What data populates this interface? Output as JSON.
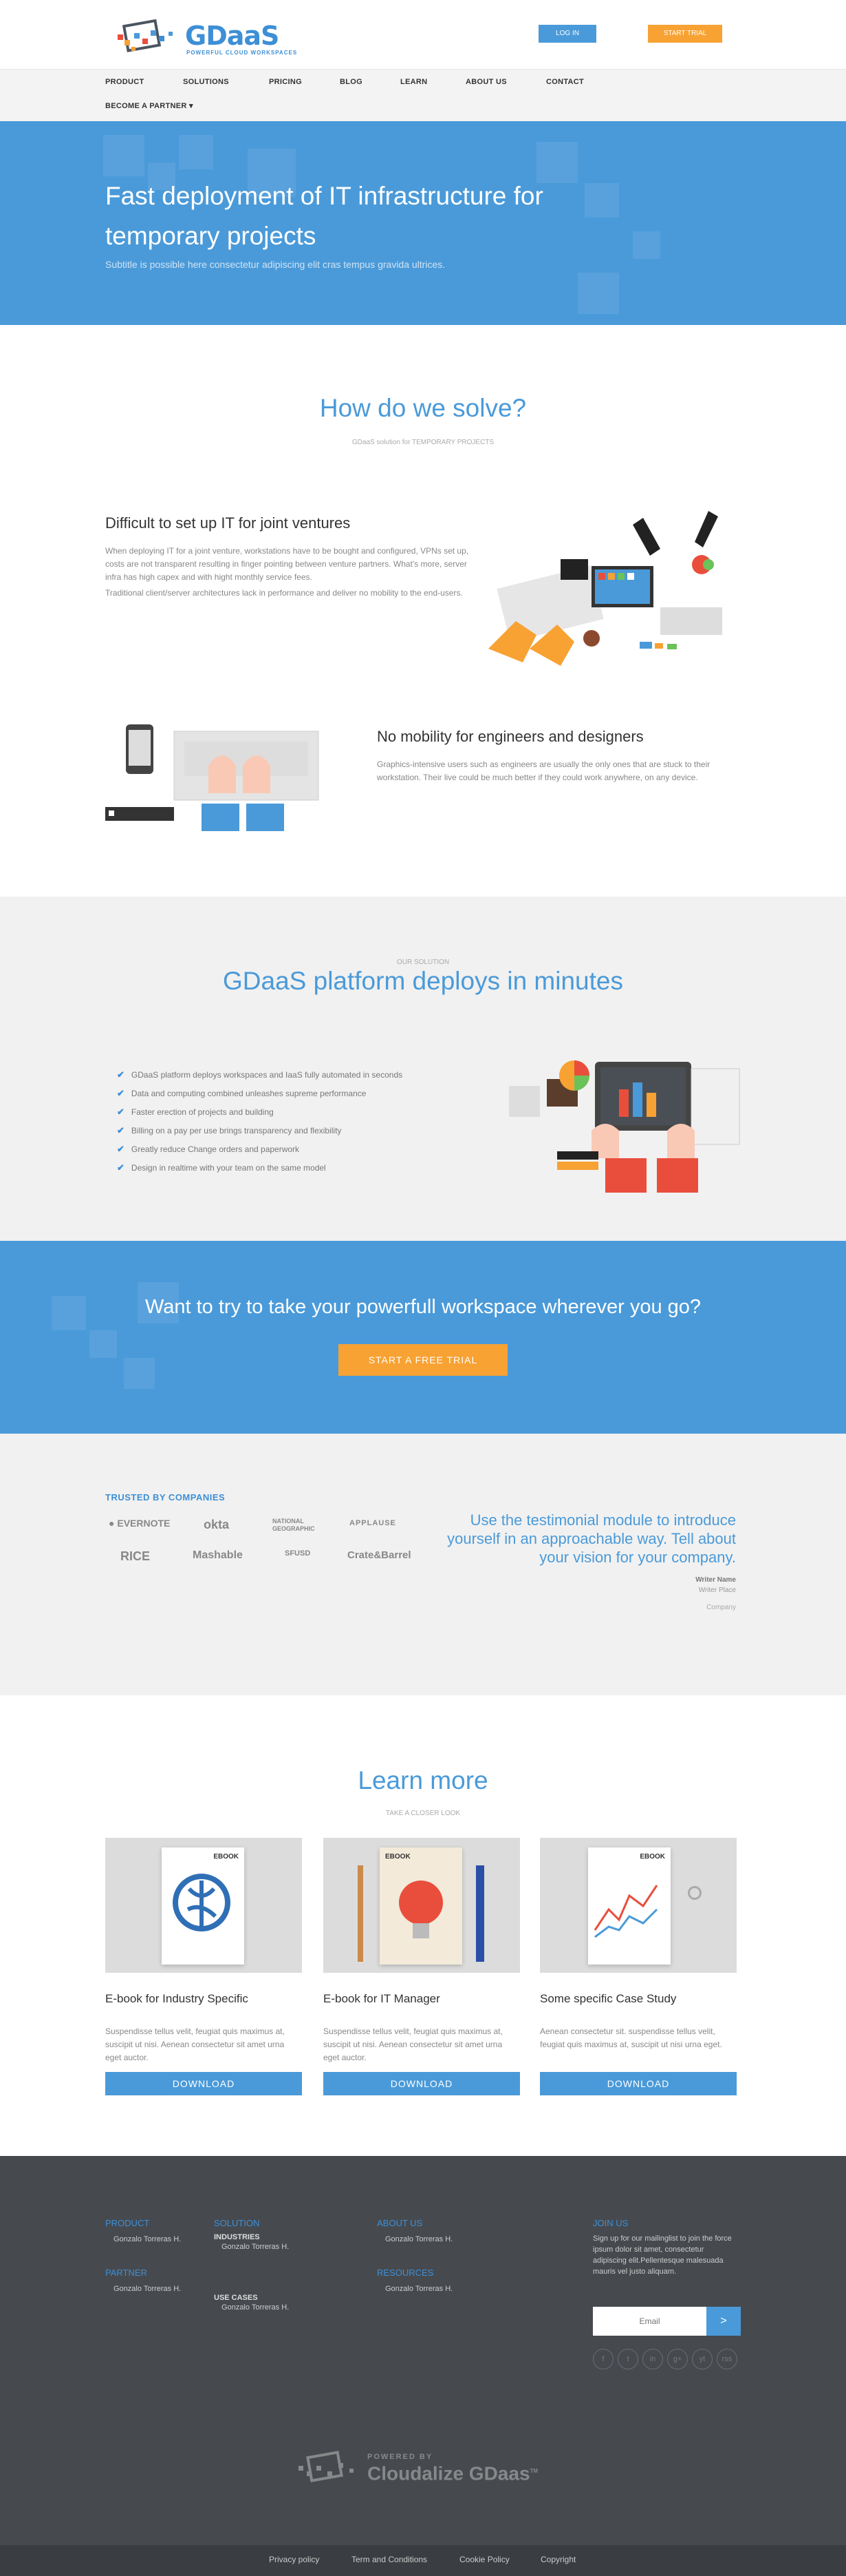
{
  "header": {
    "logo_name": "GDaaS",
    "logo_tagline": "POWERFUL CLOUD WORKSPACES",
    "login_label": "LOG IN",
    "trial_label": "START TRIAL"
  },
  "nav": {
    "items": [
      "PRODUCT",
      "SOLUTIONS",
      "PRICING",
      "BLOG",
      "LEARN",
      "ABOUT US",
      "CONTACT"
    ],
    "partner": "BECOME A PARTNER"
  },
  "hero": {
    "title": "Fast deployment of IT infrastructure for temporary projects",
    "subtitle": "Subtitle is possible here consectetur adipiscing elit cras tempus gravida ultrices."
  },
  "solve": {
    "title": "How do we solve?",
    "subtitle": "GDaaS solution for TEMPORARY PROJECTS",
    "item1_title": "Difficult to set up IT for joint ventures",
    "item1_p1": "When deploying IT for a joint venture, workstations have to be bought and configured, VPNs set up, costs are not transparent resulting in finger pointing between venture partners. What's more, server infra has high capex and with hight monthly service fees.",
    "item1_p2": "Traditional client/server architectures lack in performance and deliver no mobility to the end-users.",
    "item2_title": "No mobility for engineers and designers",
    "item2_p1": "Graphics-intensive users such as engineers are usually the only ones that are stuck to their workstation. Their live could be much better if they could work anywhere, on any device."
  },
  "solution": {
    "eyebrow": "OUR SOLUTION",
    "title": "GDaaS platform deploys in minutes",
    "bullets": [
      "GDaaS platform deploys workspaces and IaaS fully automated in seconds",
      "Data and computing combined unleashes supreme performance",
      "Faster erection of projects and building",
      "Billing on a pay per use brings transparency and flexibility",
      "Greatly reduce Change orders and paperwork",
      "Design in realtime with your team on the same model"
    ]
  },
  "cta": {
    "title": "Want to try to take your powerfull workspace wherever you go?",
    "button": "START A FREE TRIAL"
  },
  "trusted": {
    "label": "TRUSTED BY COMPANIES",
    "brands": [
      "EVERNOTE",
      "okta",
      "NATIONAL GEOGRAPHIC",
      "APPLAUSE",
      "RICE",
      "Mashable",
      "SFUSD",
      "Crate&Barrel"
    ],
    "quote": "Use the testimonial module to introduce yourself in an approachable way. Tell about your vision for your company.",
    "writer_name": "Writer Name",
    "writer_place": "Writer Place",
    "company": "Company"
  },
  "learn": {
    "title": "Learn more",
    "subtitle": "TAKE A CLOSER LOOK",
    "cards": [
      {
        "title": "E-book for Industry Specific",
        "text": "Suspendisse tellus velit, feugiat quis maximus at, suscipit ut nisi. Aenean consectetur sit amet urna eget auctor.",
        "button": "DOWNLOAD",
        "badge": "EBOOK"
      },
      {
        "title": "E-book for IT Manager",
        "text": "Suspendisse tellus velit, feugiat quis maximus at, suscipit ut nisi. Aenean consectetur sit amet urna eget auctor.",
        "button": "DOWNLOAD",
        "badge": "EBOOK"
      },
      {
        "title": "Some specific Case Study",
        "text": "Aenean consectetur sit. suspendisse tellus velit, feugiat quis maximus at, suscipit ut nisi urna eget.",
        "button": "DOWNLOAD",
        "badge": "EBOOK"
      }
    ]
  },
  "footer": {
    "product": "PRODUCT",
    "product_link": "Gonzalo Torreras H.",
    "partner": "PARTNER",
    "partner_link": "Gonzalo Torreras H.",
    "solution": "SOLUTION",
    "solution_link": "Gonzalo Torreras H.",
    "industries": "INDUSTRIES",
    "industries_link": "Gonzalo Torreras H.",
    "use_cases": "USE CASES",
    "use_cases_link": "Gonzalo Torreras H.",
    "about": "ABOUT US",
    "about_link": "Gonzalo Torreras H.",
    "resources": "RESOURCES",
    "resources_link": "Gonzalo Torreras H.",
    "join": "JOIN US",
    "join_text": "Sign up for our mailinglist to join the force ipsum dolor sit amet, consectetur adipiscing elit.Pellentesque malesuada mauris vel justo aliquam.",
    "email_placeholder": "Email",
    "submit": ">",
    "social": [
      "f",
      "t",
      "in",
      "g+",
      "yt",
      "rss"
    ],
    "powered_by": "POWERED BY",
    "powered_name": "Cloudalize GDaas",
    "tm": "TM"
  },
  "bottom": {
    "links": [
      "Privacy policy",
      "Term and Conditions",
      "Cookie Policy",
      "Copyright"
    ]
  },
  "colors": {
    "accent": "#4a9ad9",
    "orange": "#f7a233",
    "footer": "#464a4f"
  }
}
